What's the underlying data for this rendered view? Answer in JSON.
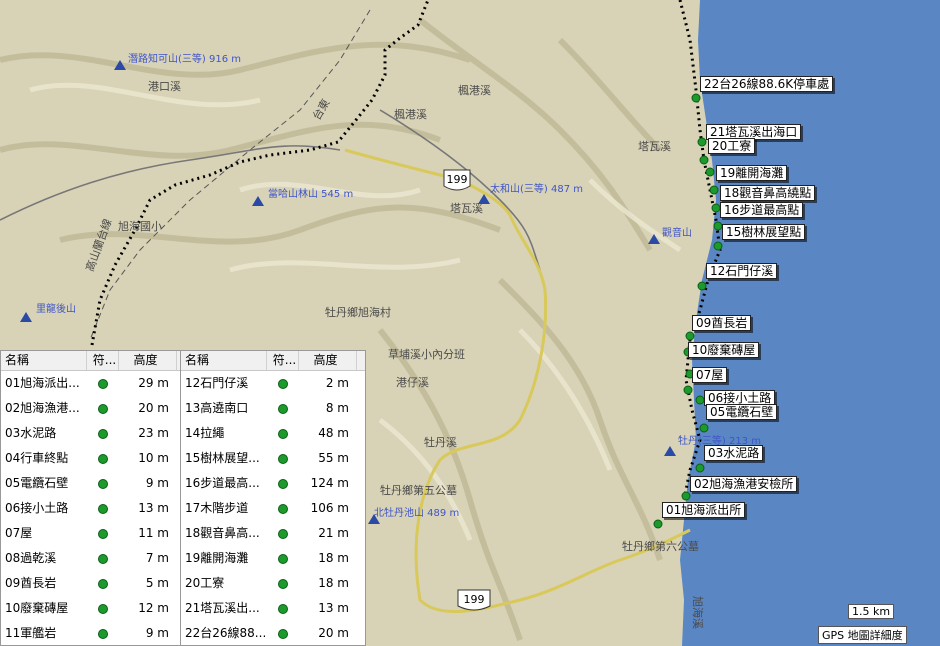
{
  "colors": {
    "sea": "#5b86c4",
    "land": "#d8d3b6",
    "track": "#000000",
    "road": "#d9c85a",
    "waypoint": "#1d9a2c",
    "peak": "#2a4aa5"
  },
  "map_labels": {
    "river1": "港口溪",
    "river2": "楓港溪",
    "river3": "楓港溪",
    "river4": "塔瓦溪",
    "river5": "塔瓦溪",
    "area1": "牡丹鄉旭海村",
    "area2": "草埔溪小內分班",
    "area3": "牡丹鄉第五公墓",
    "area4": "牡丹鄉第六公墓",
    "road_tw": "台東",
    "road_199": "199",
    "road_199b": "199",
    "coast": "旭海溪",
    "school": "旭海國小",
    "plateau": "高山蘭台線",
    "guanyin": "觀音山",
    "stream": "港仔溪",
    "mudan": "牡丹溪"
  },
  "peaks": [
    {
      "name": "潛路知可山(三等) 916 m"
    },
    {
      "name": "當哈山林山 545 m"
    },
    {
      "name": "太和山(三等) 487 m"
    },
    {
      "name": "里龍後山"
    },
    {
      "name": "觀音山"
    },
    {
      "name": "牡丹(三等) 213 m"
    },
    {
      "name": "北牡丹池山 489 m"
    }
  ],
  "waypoint_labels": [
    "22台26線88.6K停車處",
    "21塔瓦溪出海口",
    "20工寮",
    "19離開海灘",
    "18觀音鼻高繞點",
    "16步道最高點",
    "15樹林展望點",
    "12石門仔溪",
    "09酋長岩",
    "10廢棄磚屋",
    "07屋",
    "06接小土路",
    "05電纜石壁",
    "03水泥路",
    "02旭海漁港安檢所",
    "01旭海派出所"
  ],
  "table_headers": {
    "name": "名稱",
    "sym": "符...",
    "alt": "高度"
  },
  "table_left": [
    {
      "name": "01旭海派出...",
      "alt": "29 m"
    },
    {
      "name": "02旭海漁港...",
      "alt": "20 m"
    },
    {
      "name": "03水泥路",
      "alt": "23 m"
    },
    {
      "name": "04行車終點",
      "alt": "10 m"
    },
    {
      "name": "05電纜石壁",
      "alt": "9 m"
    },
    {
      "name": "06接小土路",
      "alt": "13 m"
    },
    {
      "name": "07屋",
      "alt": "11 m"
    },
    {
      "name": "08過乾溪",
      "alt": "7 m"
    },
    {
      "name": "09酋長岩",
      "alt": "5 m"
    },
    {
      "name": "10廢棄磚屋",
      "alt": "12 m"
    },
    {
      "name": "11軍艦岩",
      "alt": "9 m"
    }
  ],
  "table_right": [
    {
      "name": "12石門仔溪",
      "alt": "2 m"
    },
    {
      "name": "13高遶南口",
      "alt": "8 m"
    },
    {
      "name": "14拉繩",
      "alt": "48 m"
    },
    {
      "name": "15樹林展望...",
      "alt": "55 m"
    },
    {
      "name": "16步道最高...",
      "alt": "124 m"
    },
    {
      "name": "17木階步道",
      "alt": "106 m"
    },
    {
      "name": "18觀音鼻高...",
      "alt": "21 m"
    },
    {
      "name": "19離開海灘",
      "alt": "18 m"
    },
    {
      "name": "20工寮",
      "alt": "18 m"
    },
    {
      "name": "21塔瓦溪出...",
      "alt": "13 m"
    },
    {
      "name": "22台26線88...",
      "alt": "20 m"
    }
  ],
  "scale": {
    "distance": "1.5 km",
    "detail": "GPS 地圖詳細度"
  }
}
